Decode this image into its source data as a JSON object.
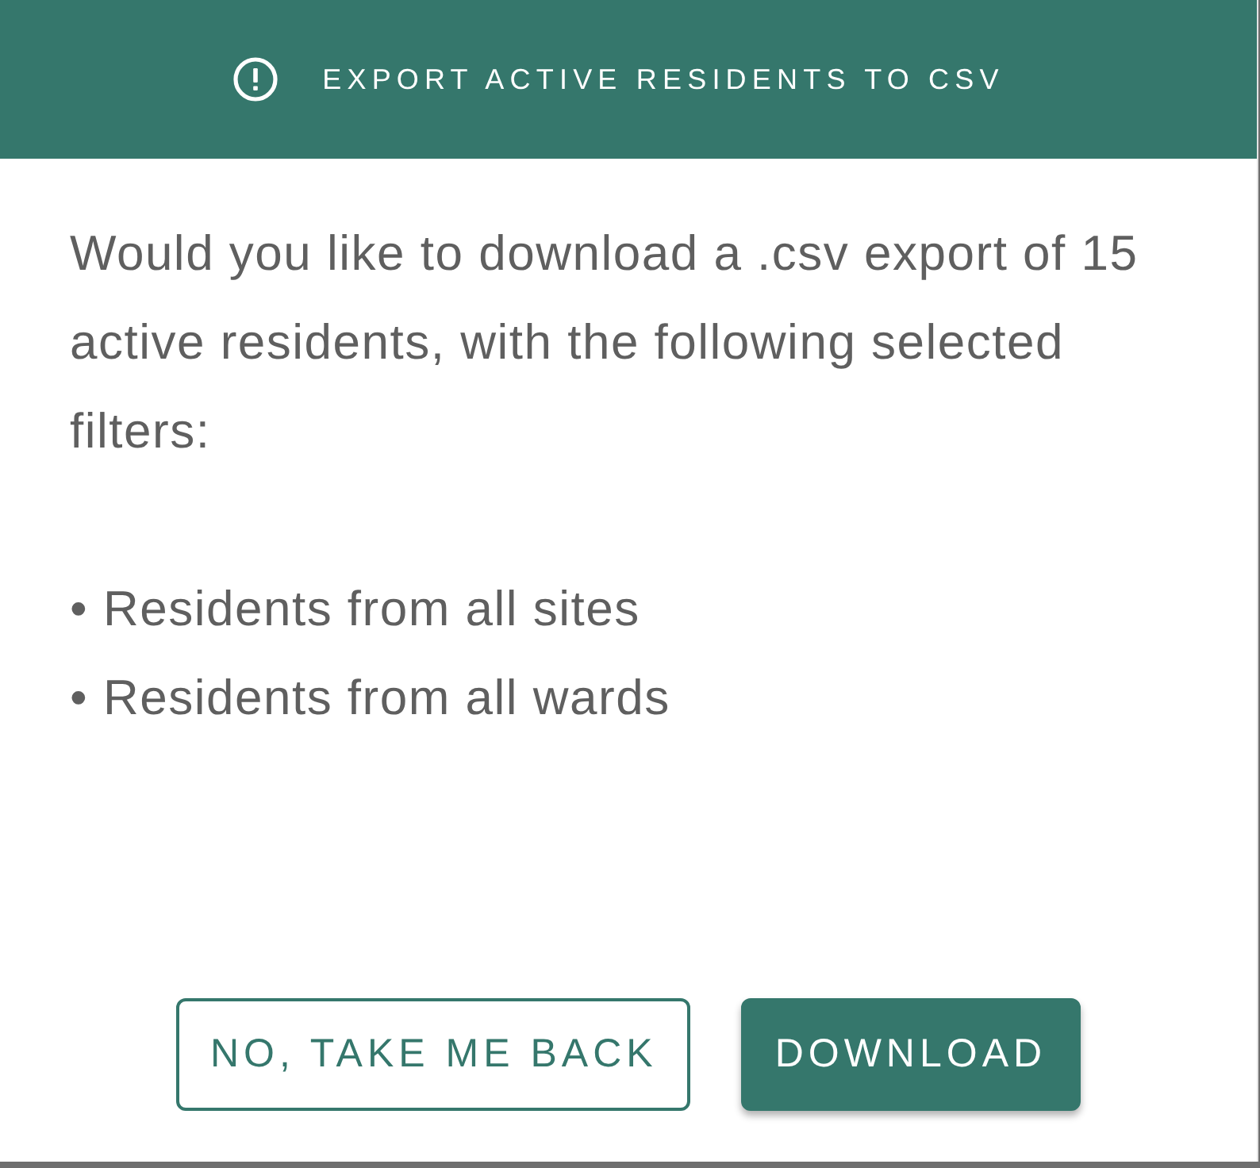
{
  "dialog": {
    "title": "EXPORT ACTIVE RESIDENTS TO CSV",
    "message": "Would you like to download a .csv export of 15 active residents, with the following selected filters:",
    "filters": [
      "• Residents from all sites",
      "• Residents from all wards"
    ],
    "buttons": [
      {
        "label": "NO, TAKE ME BACK",
        "kind": "outlined"
      },
      {
        "label": "DOWNLOAD",
        "kind": "filled"
      }
    ]
  }
}
